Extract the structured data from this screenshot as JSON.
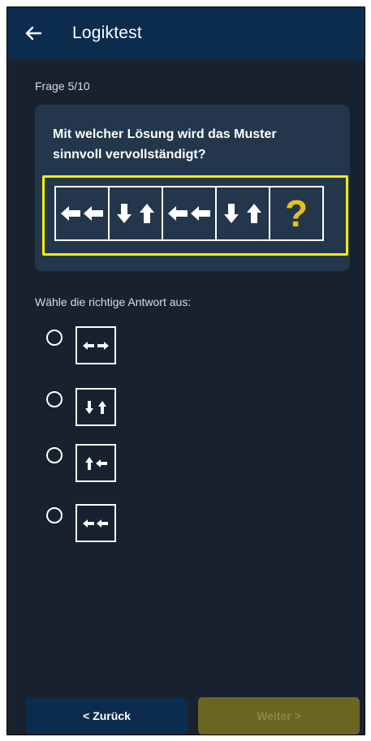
{
  "app_bar": {
    "title": "Logiktest",
    "back_icon": "arrow-left-icon"
  },
  "progress": "Frage 5/10",
  "question": {
    "text": "Mit welcher Lösung wird das Muster sinnvoll vervollständigt?",
    "sequence": [
      {
        "icons": [
          "arrow-left",
          "arrow-left"
        ]
      },
      {
        "icons": [
          "arrow-down",
          "arrow-up"
        ]
      },
      {
        "icons": [
          "arrow-left",
          "arrow-left"
        ]
      },
      {
        "icons": [
          "arrow-down",
          "arrow-up"
        ]
      },
      {
        "symbol": "?"
      }
    ],
    "highlight_color": "#f4ee0a",
    "question_mark_color": "#e4c21a"
  },
  "answer_prompt": "Wähle die richtige Antwort aus:",
  "options": [
    {
      "icons": [
        "arrow-left",
        "arrow-right"
      ],
      "selected": false
    },
    {
      "icons": [
        "arrow-down",
        "arrow-up"
      ],
      "selected": false
    },
    {
      "icons": [
        "arrow-up",
        "arrow-left"
      ],
      "selected": false
    },
    {
      "icons": [
        "arrow-left",
        "arrow-left"
      ],
      "selected": false
    }
  ],
  "buttons": {
    "back_label": "< Zurück",
    "next_label": "Weiter >",
    "next_enabled": false
  },
  "colors": {
    "background": "#17222e",
    "app_bar": "#0c2c4e",
    "card": "#23364b",
    "next_disabled": "#6a6521"
  }
}
